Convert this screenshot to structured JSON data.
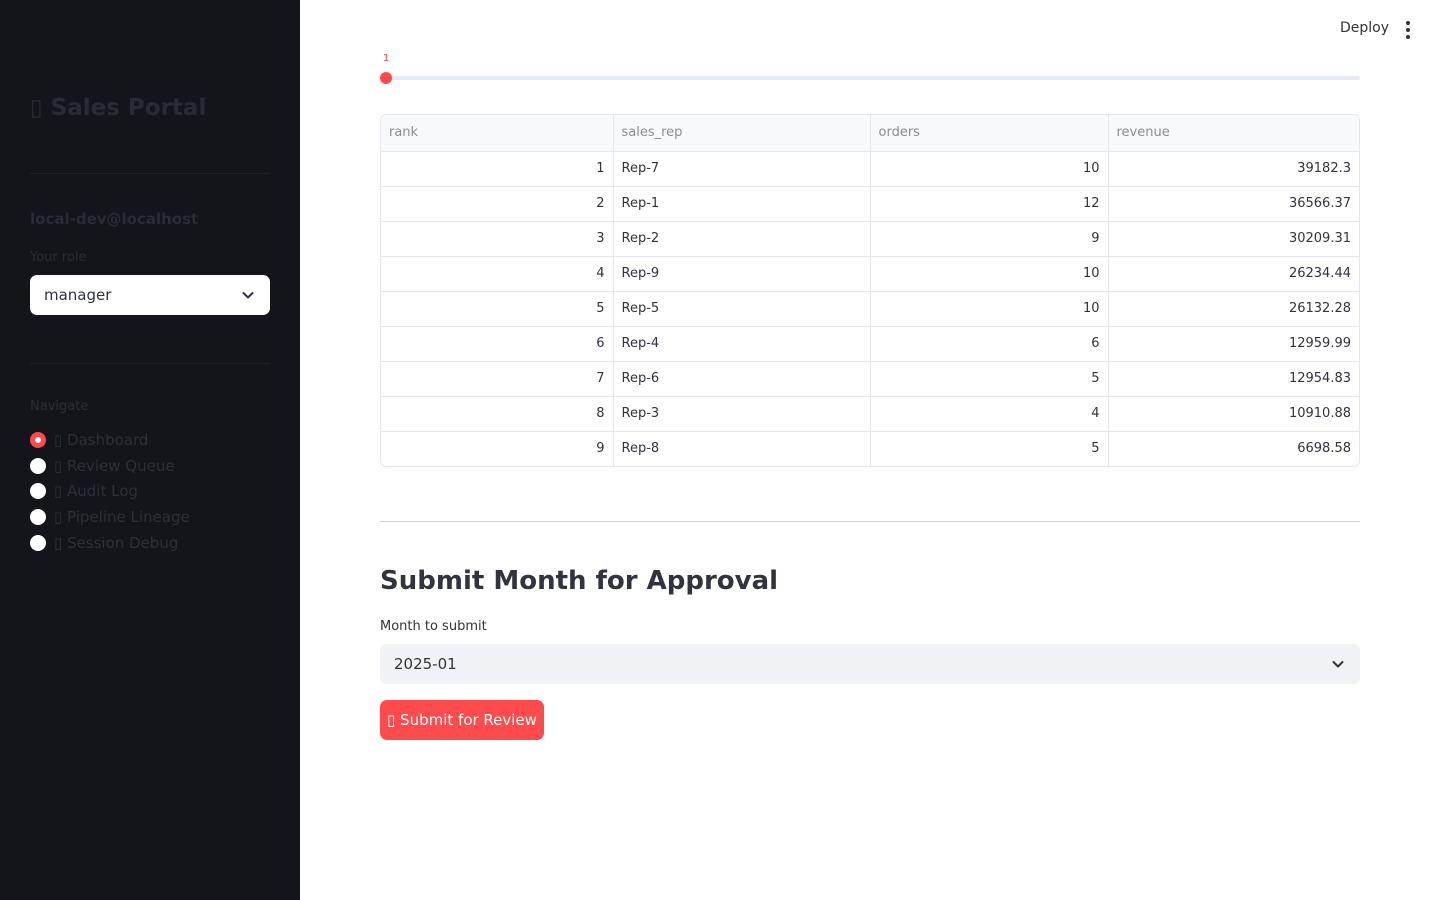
{
  "sidebar": {
    "brand": "▯ Sales Portal",
    "user": "local-dev@localhost",
    "role_label": "Your role",
    "role_value": "manager",
    "nav_label": "Navigate",
    "nav_items": [
      {
        "label": "▯ Dashboard",
        "selected": true
      },
      {
        "label": "▯ Review Queue",
        "selected": false
      },
      {
        "label": "▯ Audit Log",
        "selected": false
      },
      {
        "label": "▯ Pipeline Lineage",
        "selected": false
      },
      {
        "label": "▯ Session Debug",
        "selected": false
      }
    ]
  },
  "header": {
    "deploy_label": "Deploy",
    "menu_icon": "kebab-menu-icon"
  },
  "slider": {
    "value": "1",
    "level": 0
  },
  "table": {
    "columns": [
      "rank",
      "sales_rep",
      "orders",
      "revenue"
    ],
    "rows": [
      [
        "1",
        "Rep-7",
        "10",
        "39182.3"
      ],
      [
        "2",
        "Rep-1",
        "12",
        "36566.37"
      ],
      [
        "3",
        "Rep-2",
        "9",
        "30209.31"
      ],
      [
        "4",
        "Rep-9",
        "10",
        "26234.44"
      ],
      [
        "5",
        "Rep-5",
        "10",
        "26132.28"
      ],
      [
        "6",
        "Rep-4",
        "6",
        "12959.99"
      ],
      [
        "7",
        "Rep-6",
        "5",
        "12954.83"
      ],
      [
        "8",
        "Rep-3",
        "4",
        "10910.88"
      ],
      [
        "9",
        "Rep-8",
        "5",
        "6698.58"
      ]
    ]
  },
  "submit": {
    "title": "Submit Month for Approval",
    "month_label": "Month to submit",
    "month_value": "2025-01",
    "button_label": "▯ Submit for Review"
  },
  "colors": {
    "accent": "#ff4b4b",
    "sidebar_bg": "#13151b"
  }
}
